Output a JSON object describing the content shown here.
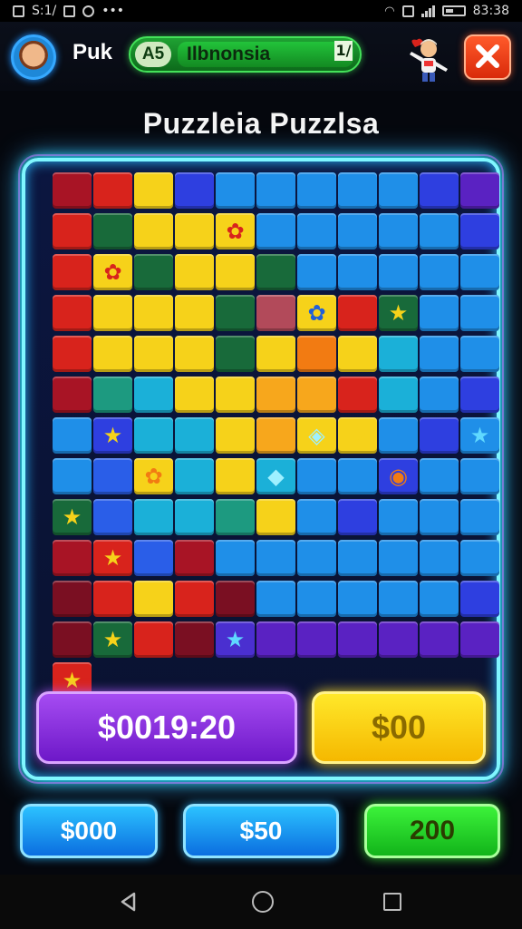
{
  "status_bar": {
    "left_text": "S:1/",
    "time": "83:38",
    "more": "•••"
  },
  "header": {
    "player_name": "Puk",
    "level_badge": "A5",
    "level_name": "Ilbnonsia",
    "level_mark": "1/",
    "close_icon": "×"
  },
  "title": "Puzzleia Puzzlsa",
  "board": {
    "cols": 11,
    "rows": 13,
    "colors": {
      "R": "#d8231c",
      "M": "#a81425",
      "D": "#7a0f22",
      "Y": "#f6d21a",
      "O": "#f27b12",
      "A": "#f7a71c",
      "G": "#186a3a",
      "T": "#1d9a80",
      "S": "#1bb0d8",
      "C": "#1f8fe8",
      "B": "#2a5ee8",
      "N": "#2e3fe0",
      "P": "#4a2fd0",
      "V": "#5a22c2",
      "K": "#b24a5a"
    },
    "rows_map": [
      "MRYNCCCCCNV",
      "RGYYYCCCCCN",
      "RYGYYGCCCCC",
      "RYYYGKYRGCC",
      "RYYYGYOYSCC",
      "MTSYYAARSCN",
      "CNSSYAYYCNC",
      "CBYSYSCCNCC",
      "GBSSTYCNCCC",
      "MRBMCCCCCCC",
      "DRYRDCCCCCN",
      "DGRDPVVVVVV",
      "R.........."
    ],
    "glyphs": [
      {
        "r": 1,
        "c": 4,
        "g": "✿",
        "color": "#d8231c"
      },
      {
        "r": 2,
        "c": 1,
        "g": "✿",
        "color": "#d8231c"
      },
      {
        "r": 3,
        "c": 6,
        "g": "✿",
        "color": "#1f5fd8"
      },
      {
        "r": 3,
        "c": 8,
        "g": "★",
        "color": "#f6d21a"
      },
      {
        "r": 6,
        "c": 1,
        "g": "★",
        "color": "#f6d21a"
      },
      {
        "r": 6,
        "c": 6,
        "g": "◈",
        "color": "#9ff0ff"
      },
      {
        "r": 6,
        "c": 7,
        "g": "★",
        "color": "#f6d21a"
      },
      {
        "r": 6,
        "c": 10,
        "g": "★",
        "color": "#5fd8ff"
      },
      {
        "r": 7,
        "c": 2,
        "g": "✿",
        "color": "#f27b12"
      },
      {
        "r": 7,
        "c": 5,
        "g": "◆",
        "color": "#9ff0ff"
      },
      {
        "r": 7,
        "c": 8,
        "g": "◉",
        "color": "#f27b12"
      },
      {
        "r": 8,
        "c": 0,
        "g": "★",
        "color": "#f6d21a"
      },
      {
        "r": 9,
        "c": 1,
        "g": "★",
        "color": "#f6d21a"
      },
      {
        "r": 10,
        "c": 2,
        "g": "★",
        "color": "#f6d21a"
      },
      {
        "r": 11,
        "c": 1,
        "g": "★",
        "color": "#f6d21a"
      },
      {
        "r": 11,
        "c": 4,
        "g": "★",
        "color": "#5fd8ff"
      },
      {
        "r": 12,
        "c": 0,
        "g": "★",
        "color": "#f6d21a"
      }
    ]
  },
  "buttons": {
    "purple_price": "$0019:20",
    "yellow_price": "$00",
    "option_1": "$000",
    "option_2": "$50",
    "option_3": "200"
  }
}
